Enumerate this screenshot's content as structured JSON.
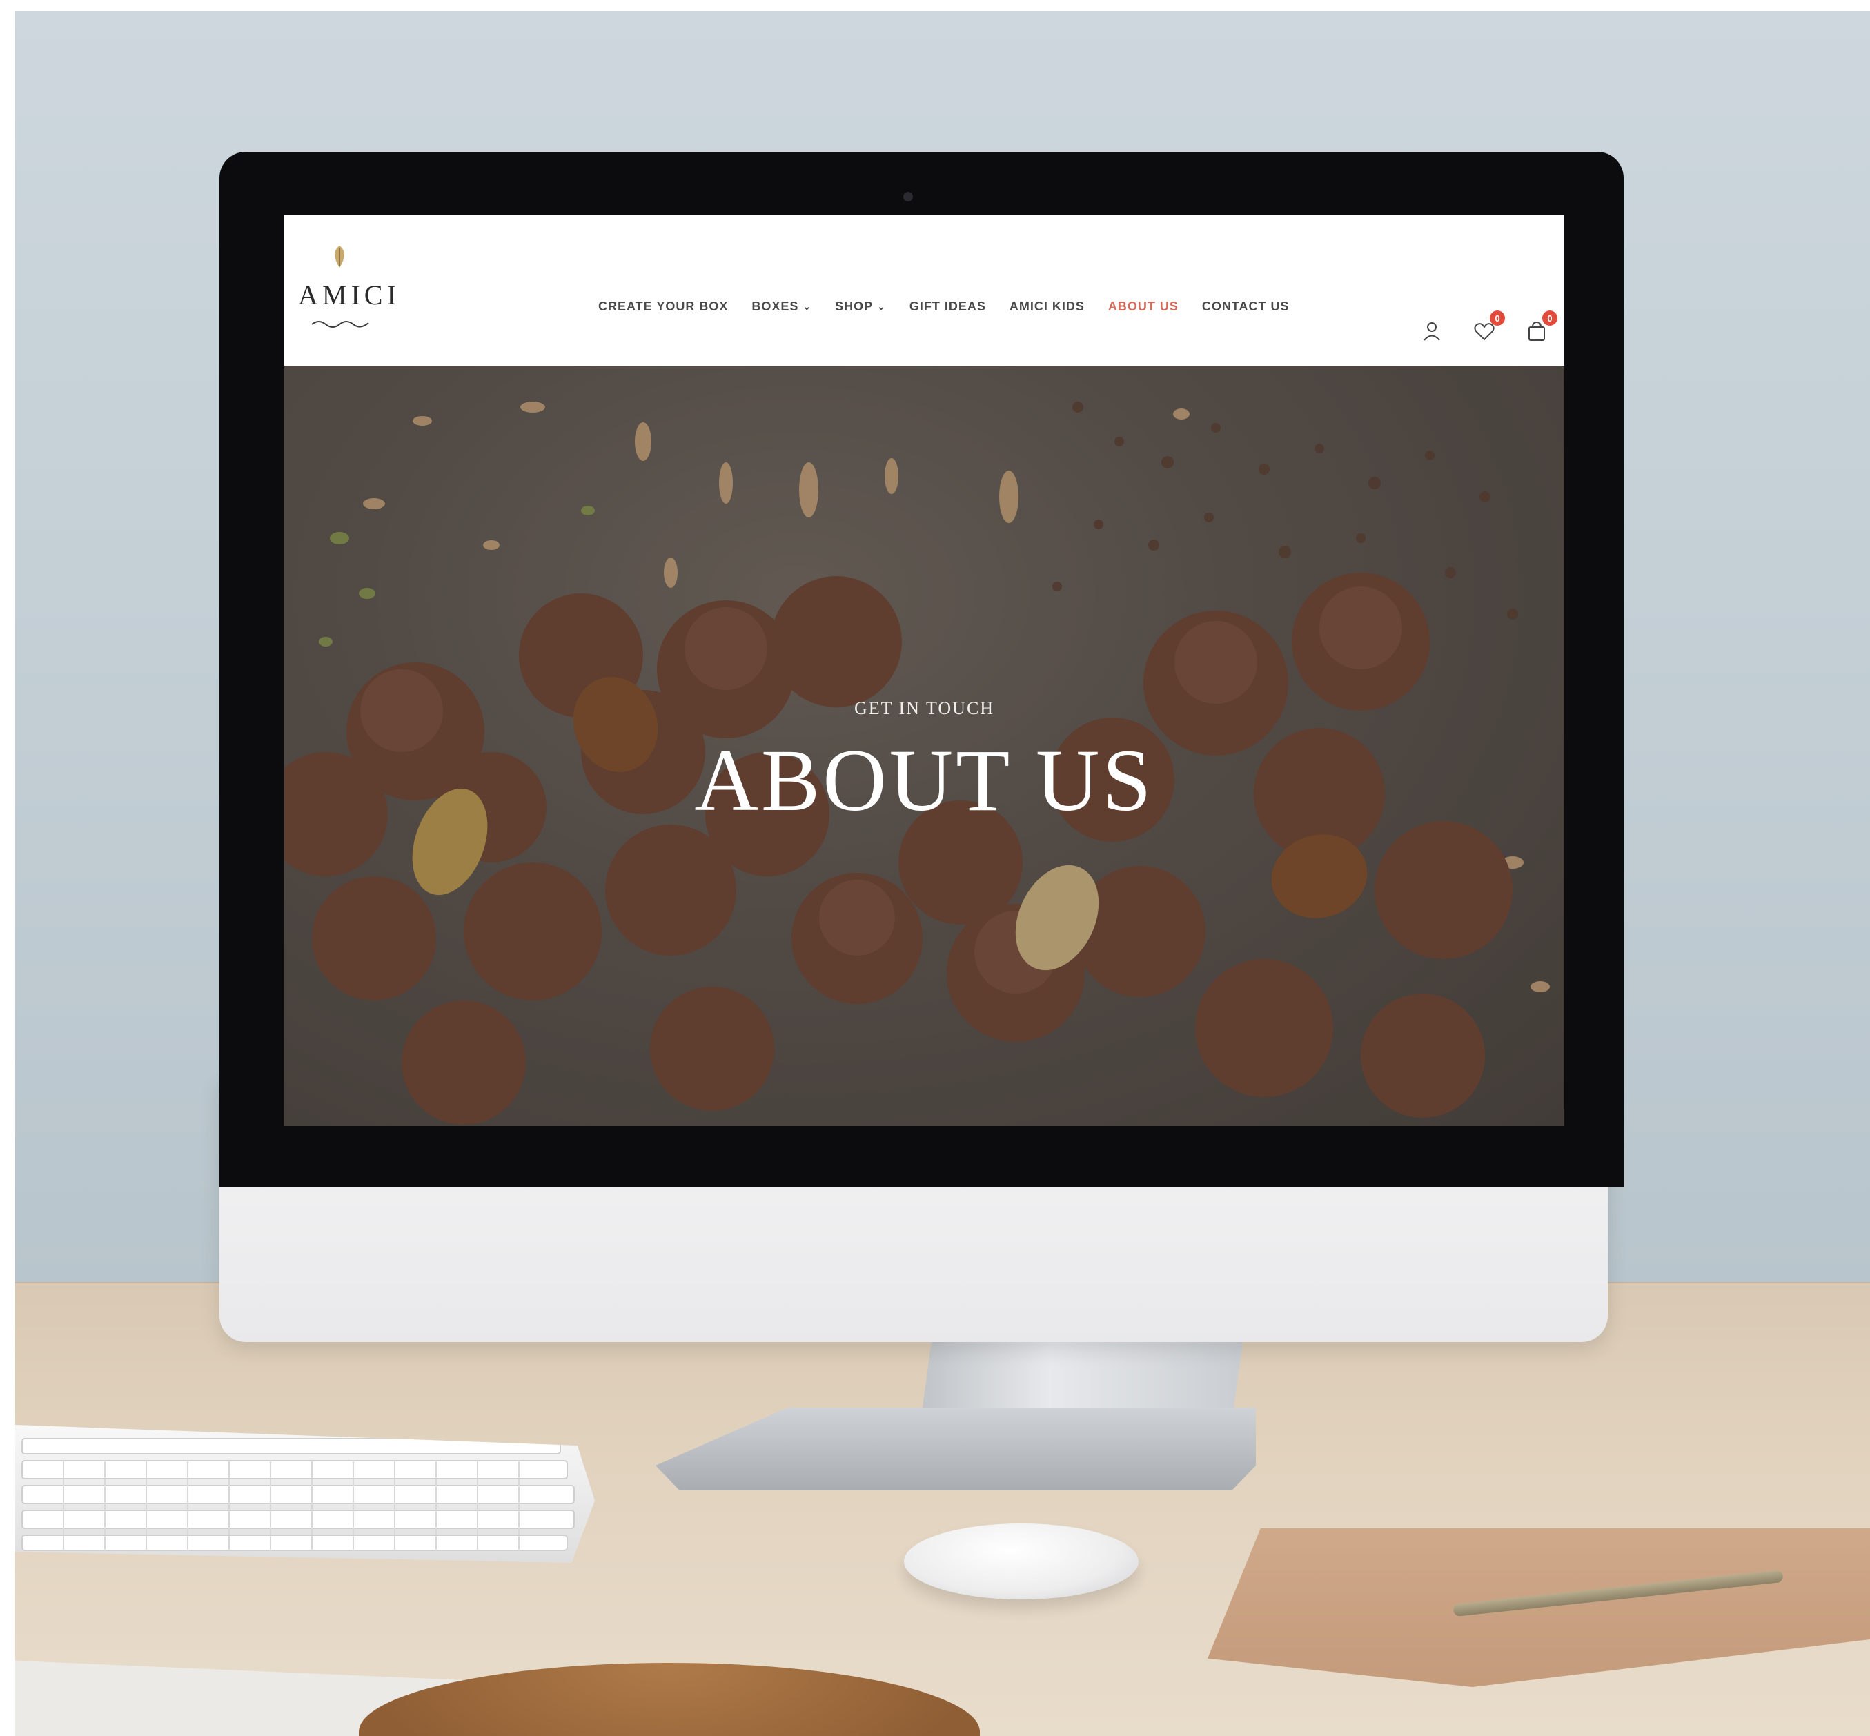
{
  "site": {
    "brand": "AMICI",
    "nav": [
      {
        "label": "CREATE YOUR BOX",
        "dropdown": false,
        "active": false
      },
      {
        "label": "BOXES",
        "dropdown": true,
        "active": false
      },
      {
        "label": "SHOP",
        "dropdown": true,
        "active": false
      },
      {
        "label": "GIFT IDEAS",
        "dropdown": false,
        "active": false
      },
      {
        "label": "AMICI KIDS",
        "dropdown": false,
        "active": false
      },
      {
        "label": "ABOUT US",
        "dropdown": false,
        "active": true
      },
      {
        "label": "CONTACT US",
        "dropdown": false,
        "active": false
      }
    ],
    "icons": {
      "account": "user-icon",
      "wishlist": "heart-icon",
      "cart": "shopping-bag-icon"
    },
    "wishlist_count": "0",
    "cart_count": "0",
    "active_color": "#d56a5a",
    "badge_color": "#e24b3b"
  },
  "hero": {
    "kicker": "GET IN TOUCH",
    "title": "ABOUT US"
  }
}
